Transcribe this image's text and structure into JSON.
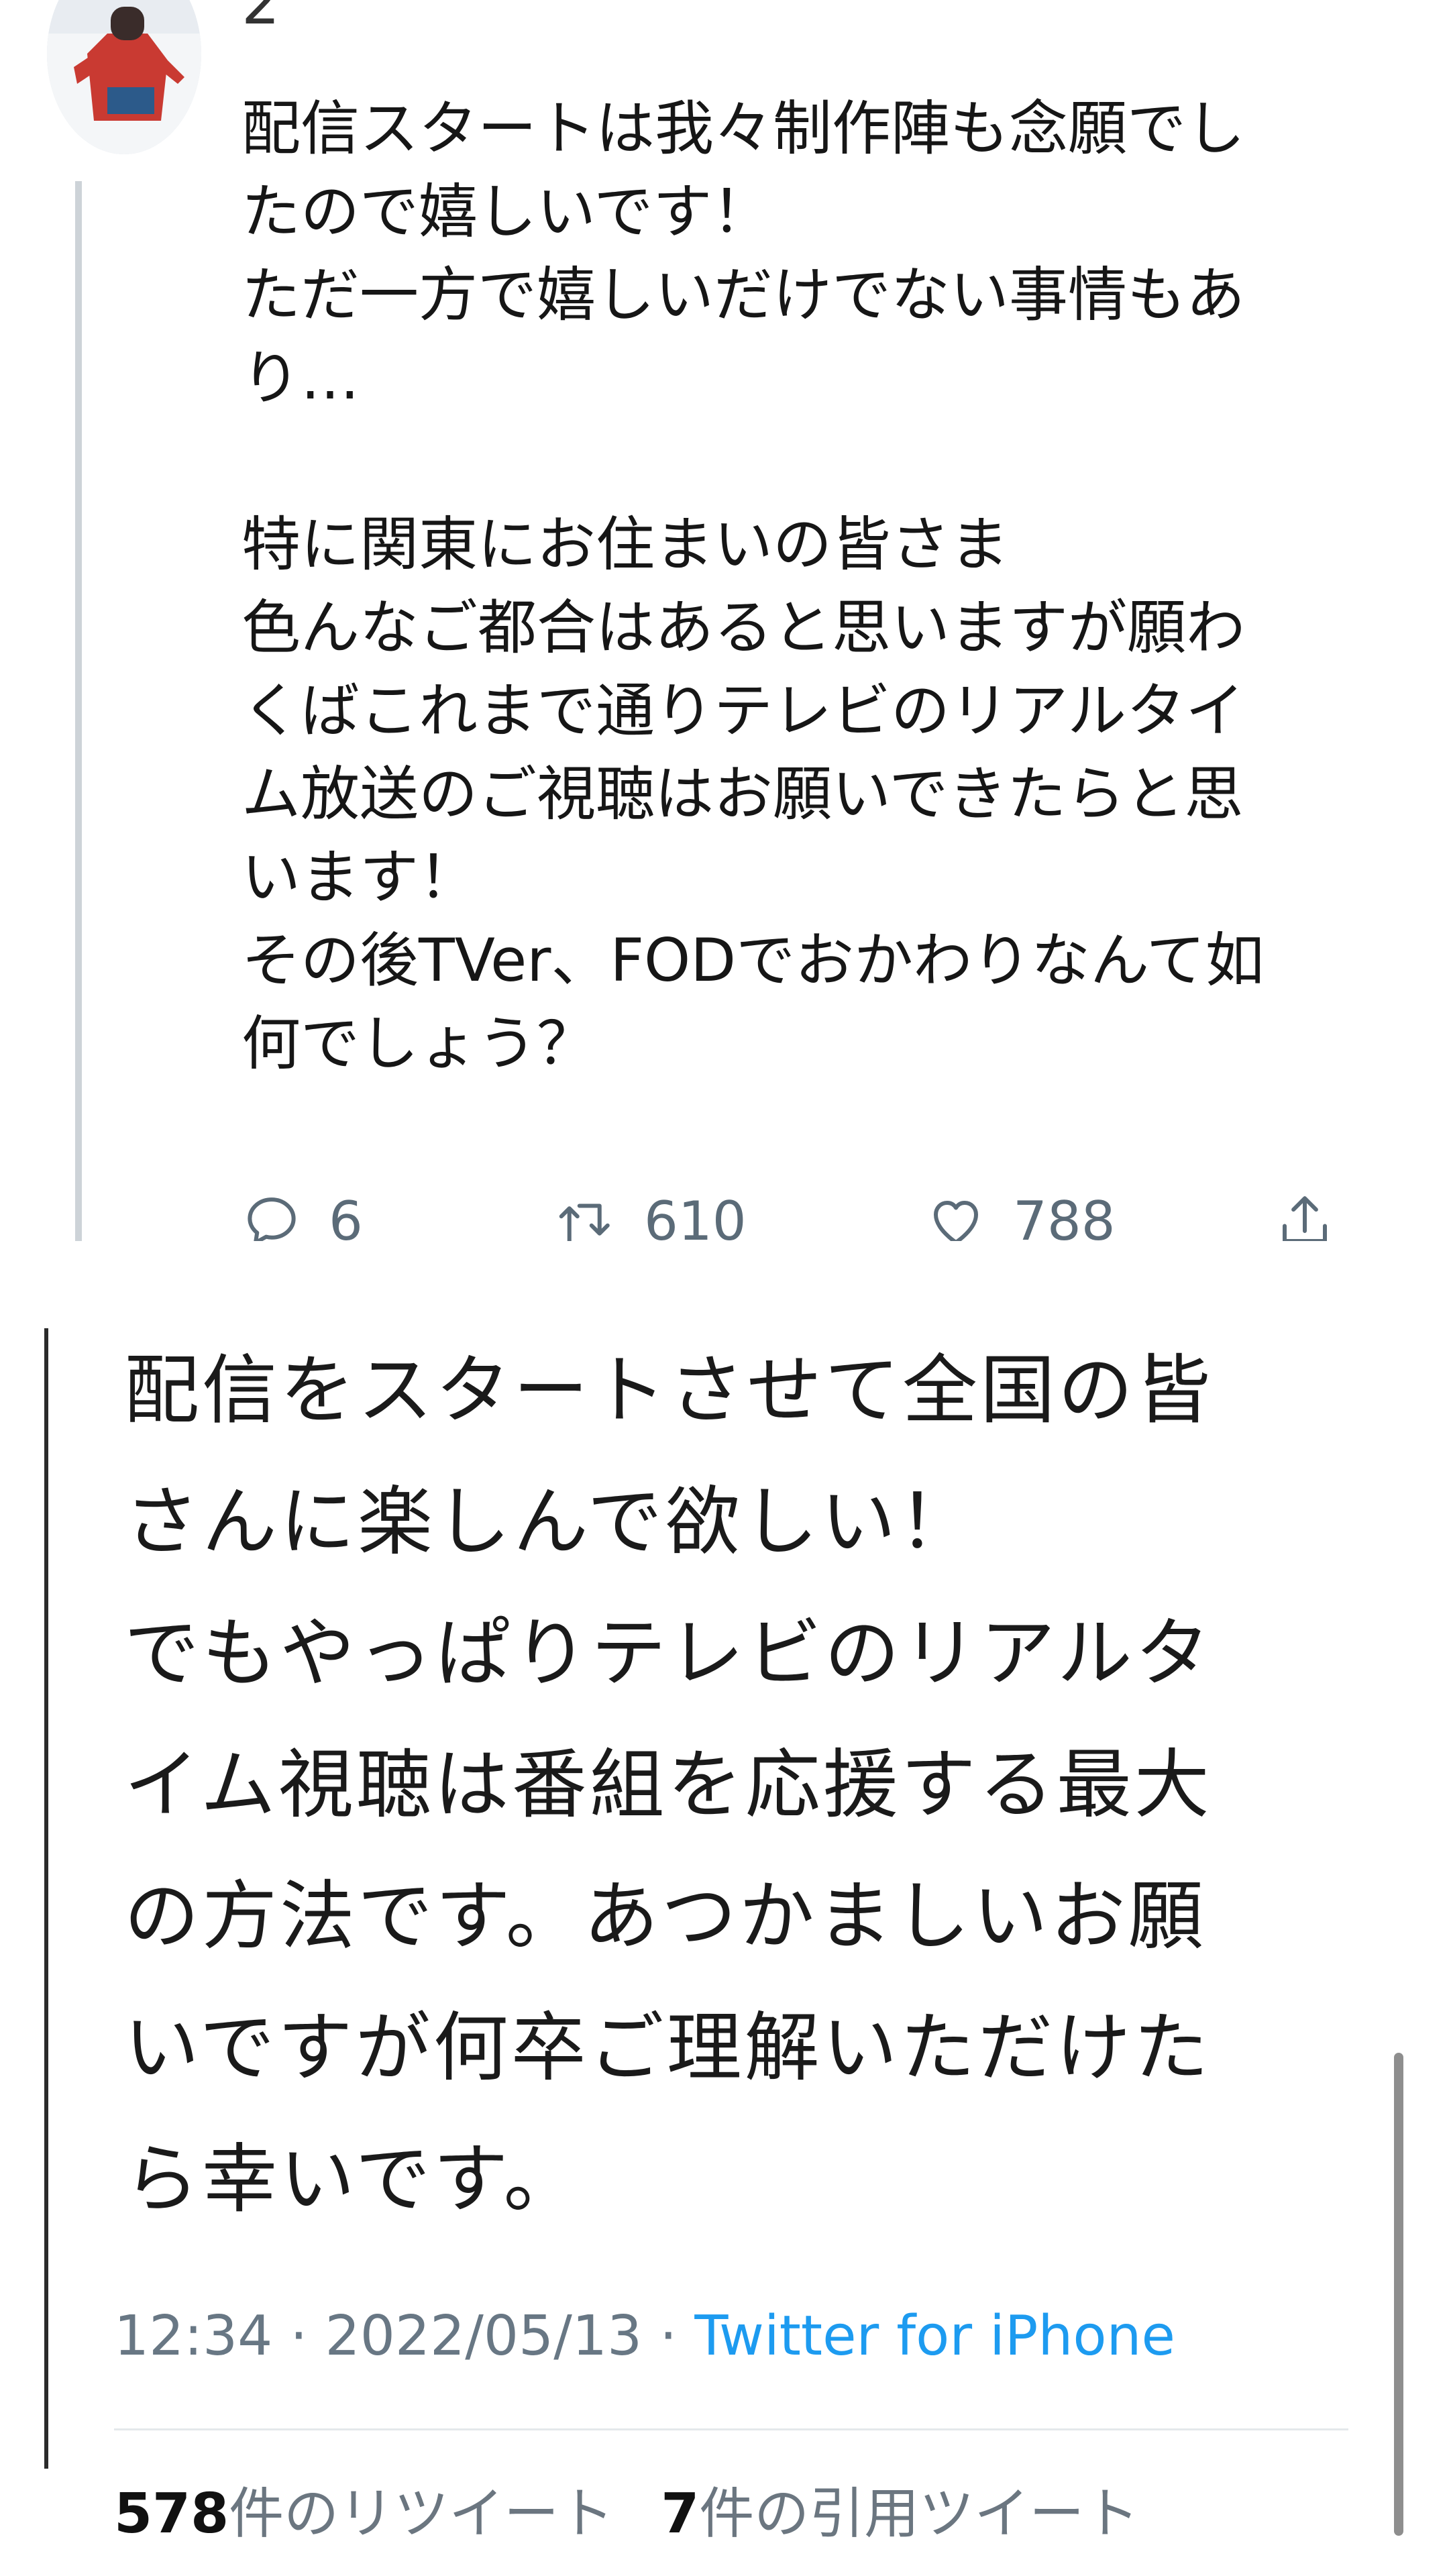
{
  "reply_tweet": {
    "thread_number": "2",
    "body_paragraphs": [
      {
        "lines": [
          "配信スタートは我々制作陣も念願でし",
          "たので嬉しいです！",
          "ただ一方で嬉しいだけでない事情もあ",
          "り…"
        ]
      },
      {
        "lines": [
          "特に関東にお住まいの皆さま",
          "色んなご都合はあると思いますが願わ",
          "くばこれまで通りテレビのリアルタイ",
          "ム放送のご視聴はお願いできたらと思",
          "います！",
          "その後TVer、FODでおかわりなんて如",
          "何でしょう？"
        ]
      }
    ],
    "actions": {
      "reply": {
        "icon": "reply-icon",
        "count": "6"
      },
      "retweet": {
        "icon": "retweet-icon",
        "count": "610"
      },
      "like": {
        "icon": "heart-icon",
        "count": "788"
      },
      "share": {
        "icon": "share-icon"
      }
    }
  },
  "main_tweet": {
    "body_lines": [
      "配信をスタートさせて全国の皆",
      "さんに楽しんで欲しい！",
      "でもやっぱりテレビのリアルタ",
      "イム視聴は番組を応援する最大",
      "の方法です。あつかましいお願",
      "いですが何卒ご理解いただけた",
      "ら幸いです。"
    ],
    "time": "12:34",
    "separator": "·",
    "date": "2022/05/13",
    "source": "Twitter for iPhone",
    "stats": {
      "retweet_count": "578",
      "retweet_label": "件のリツイート",
      "quote_count": "7",
      "quote_label": "件の引用ツイート"
    }
  },
  "colors": {
    "link": "#1d9bf0",
    "meta_text": "#687784",
    "action_icon": "#5b6b78",
    "thread_line": "#cdd3d8"
  }
}
